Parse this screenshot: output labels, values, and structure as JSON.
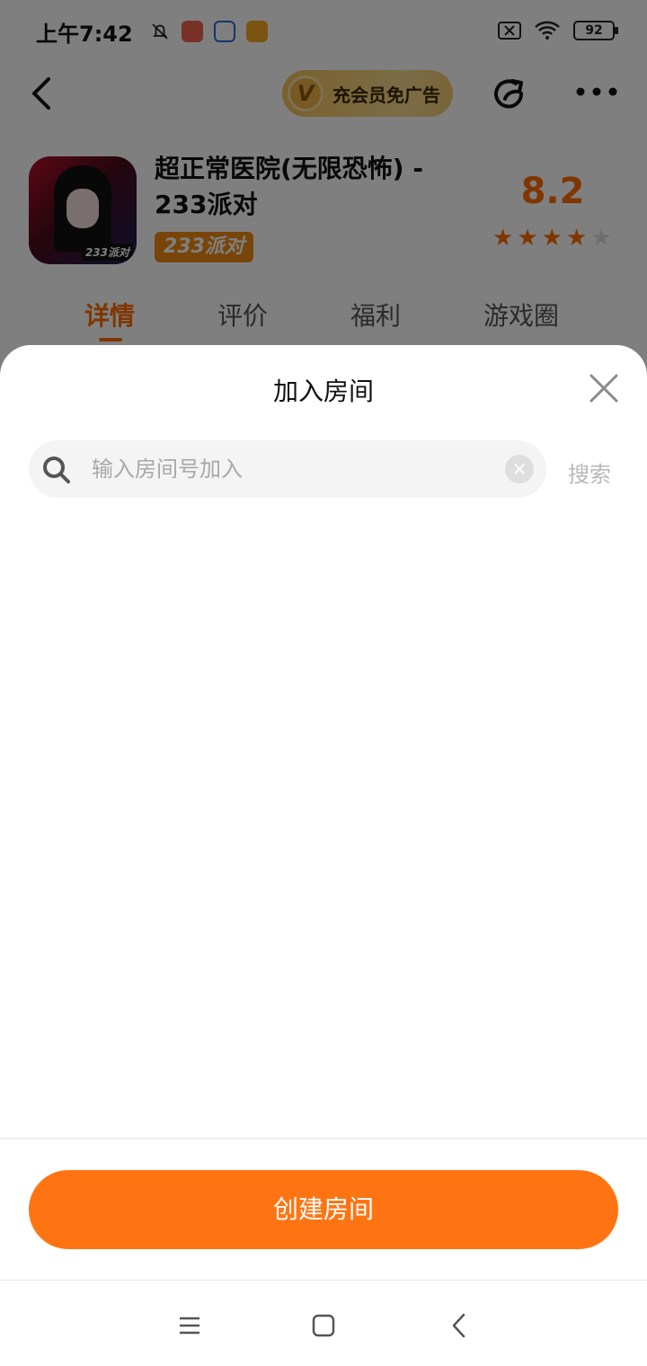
{
  "status_bar": {
    "time": "上午7:42",
    "battery": "92",
    "icons": [
      "bell-muted-icon",
      "app-red-icon",
      "iflytek-icon",
      "app-orange-icon",
      "sim-off-icon",
      "wifi-icon",
      "battery-icon"
    ]
  },
  "header": {
    "vip_badge": "V",
    "vip_label": "充会员免广告",
    "icons": [
      "back-icon",
      "share-icon",
      "more-icon"
    ]
  },
  "game": {
    "icon_tag": "233派对",
    "title": "超正常医院(无限恐怖) - 233派对",
    "badge": "233派对",
    "rating": "8.2",
    "stars_filled": 4,
    "stars_total": 5
  },
  "tabs": [
    {
      "label": "详情",
      "active": true
    },
    {
      "label": "评价",
      "active": false
    },
    {
      "label": "福利",
      "active": false
    },
    {
      "label": "游戏圈",
      "active": false
    }
  ],
  "sheet": {
    "title": "加入房间",
    "search": {
      "placeholder": "输入房间号加入",
      "value": "",
      "action_label": "搜索"
    },
    "create_button_label": "创建房间"
  },
  "colors": {
    "accent": "#ff7412",
    "rating": "#ff6d00",
    "star_filled": "#ff6d00",
    "star_empty": "#dddddd"
  },
  "nav_bar": {
    "icons": [
      "menu-icon",
      "home-icon",
      "back-nav-icon"
    ]
  }
}
